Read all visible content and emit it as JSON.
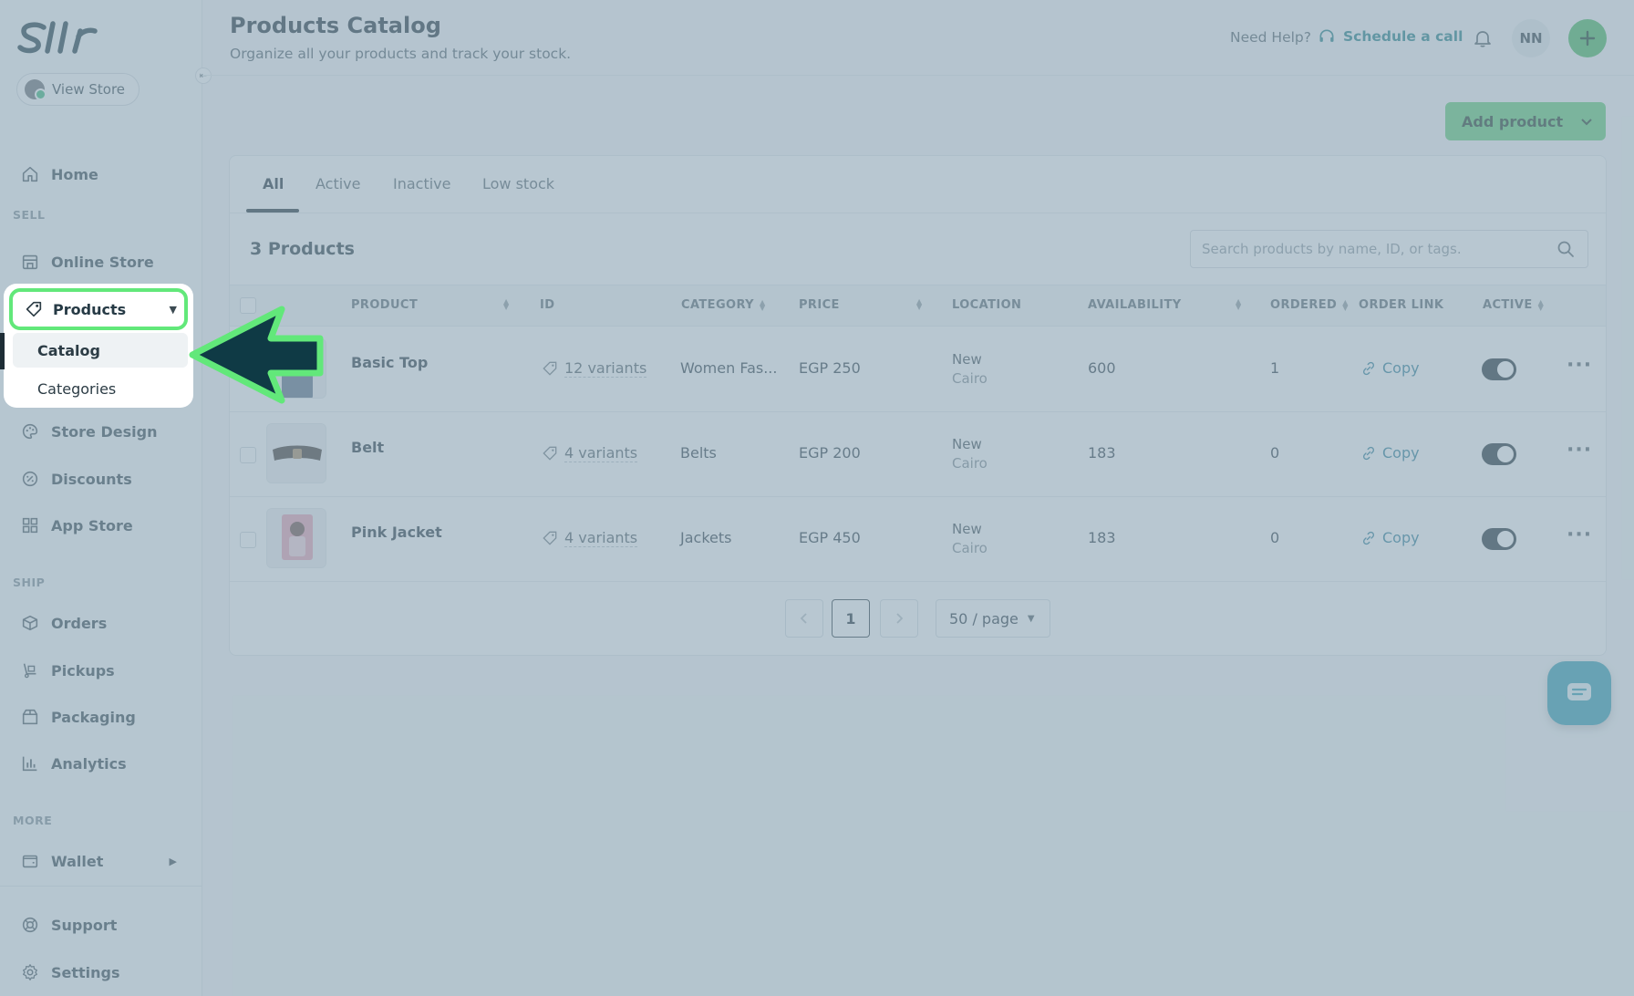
{
  "app": {
    "logo_text": "Sllr",
    "view_store_label": "View Store"
  },
  "sidebar": {
    "home": "Home",
    "sell_label": "SELL",
    "online_store": "Online Store",
    "products": "Products",
    "catalog": "Catalog",
    "categories": "Categories",
    "store_design": "Store Design",
    "discounts": "Discounts",
    "app_store": "App Store",
    "ship_label": "SHIP",
    "orders": "Orders",
    "pickups": "Pickups",
    "packaging": "Packaging",
    "analytics": "Analytics",
    "more_label": "MORE",
    "wallet": "Wallet",
    "support": "Support",
    "settings": "Settings"
  },
  "header": {
    "title": "Products Catalog",
    "subtitle": "Organize all your products and track your stock.",
    "need_help": "Need Help?",
    "schedule_call": "Schedule a call",
    "user_initials": "NN"
  },
  "toolbar": {
    "add_product": "Add product"
  },
  "tabs": [
    "All",
    "Active",
    "Inactive",
    "Low stock"
  ],
  "catalog": {
    "count_title": "3 Products",
    "search_placeholder": "Search products by name, ID, or tags."
  },
  "table": {
    "columns": [
      "PRODUCT",
      "ID",
      "CATEGORY",
      "PRICE",
      "LOCATION",
      "AVAILABILITY",
      "ORDERED",
      "ORDER LINK",
      "ACTIVE"
    ],
    "rows": [
      {
        "name": "Basic Top",
        "variants": "12 variants",
        "category": "Women Fas...",
        "price": "EGP 250",
        "location_line1": "New",
        "location_line2": "Cairo",
        "availability": "600",
        "ordered": "1",
        "link": "Copy",
        "active": true
      },
      {
        "name": "Belt",
        "variants": "4 variants",
        "category": "Belts",
        "price": "EGP 200",
        "location_line1": "New",
        "location_line2": "Cairo",
        "availability": "183",
        "ordered": "0",
        "link": "Copy",
        "active": true
      },
      {
        "name": "Pink Jacket",
        "variants": "4 variants",
        "category": "Jackets",
        "price": "EGP 450",
        "location_line1": "New",
        "location_line2": "Cairo",
        "availability": "183",
        "ordered": "0",
        "link": "Copy",
        "active": true
      }
    ]
  },
  "pagination": {
    "current_page": "1",
    "per_page": "50 / page"
  },
  "colors": {
    "brand_green": "#43b85c",
    "highlight_green": "#62e87a",
    "arrow_fill": "#0f3a45",
    "toggle_on": "#1e2e36",
    "link_teal": "#1e7f86",
    "overlay": "#8ca5b4"
  },
  "icons": {
    "logo": "sllr-logo",
    "home": "home-icon",
    "online_store": "storefront-icon",
    "products": "tag-icon",
    "store_design": "palette-icon",
    "discounts": "discount-icon",
    "app_store": "apps-grid-icon",
    "orders": "box-icon",
    "pickups": "dolly-icon",
    "packaging": "package-icon",
    "analytics": "bar-chart-icon",
    "wallet": "wallet-icon",
    "support": "lifebuoy-icon",
    "settings": "gear-icon",
    "schedule": "headset-icon",
    "notifications": "bell-icon",
    "add": "plus-icon",
    "search": "search-icon",
    "variants": "tag-outline-icon",
    "copy_link": "link-icon",
    "row_menu": "ellipsis-icon",
    "chat": "chat-icon",
    "pointer": "arrow-pointer"
  }
}
